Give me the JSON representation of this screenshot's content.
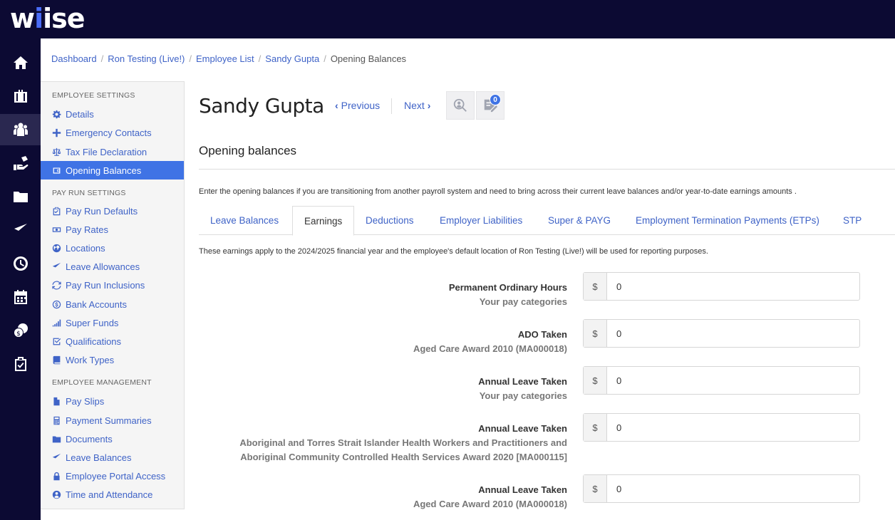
{
  "brand": {
    "logo_pre": "w",
    "logo_i1": "i",
    "logo_i2": "i",
    "logo_post": "se"
  },
  "rail": [
    "home-icon",
    "briefcase-icon",
    "people-icon",
    "hand-coin-icon",
    "folder-icon",
    "plane-icon",
    "clock-icon",
    "calendar-icon",
    "coins-icon",
    "clipboard-check-icon"
  ],
  "breadcrumb": {
    "items": [
      "Dashboard",
      "Ron Testing (Live!)",
      "Employee List",
      "Sandy Gupta"
    ],
    "current": "Opening Balances",
    "separator": "/"
  },
  "panel": {
    "sections": [
      {
        "heading": "EMPLOYEE SETTINGS",
        "items": [
          "Details",
          "Emergency Contacts",
          "Tax File Declaration",
          "Opening Balances"
        ]
      },
      {
        "heading": "PAY RUN SETTINGS",
        "items": [
          "Pay Run Defaults",
          "Pay Rates",
          "Locations",
          "Leave Allowances",
          "Pay Run Inclusions",
          "Bank Accounts",
          "Super Funds",
          "Qualifications",
          "Work Types"
        ]
      },
      {
        "heading": "EMPLOYEE MANAGEMENT",
        "items": [
          "Pay Slips",
          "Payment Summaries",
          "Documents",
          "Leave Balances",
          "Employee Portal Access",
          "Time and Attendance"
        ]
      }
    ],
    "active": "Opening Balances"
  },
  "header": {
    "employee_name": "Sandy Gupta",
    "prev_label": "Previous",
    "next_label": "Next",
    "notes_count": "0"
  },
  "page": {
    "section_title": "Opening balances",
    "intro": "Enter the opening balances if you are transitioning from another payroll system and need to bring across their current leave balances and/or year-to-date earnings amounts .",
    "apply_note": "These earnings apply to the 2024/2025 financial year and the employee's default location of Ron Testing (Live!) will be used for reporting purposes."
  },
  "tabs": {
    "items": [
      "Leave Balances",
      "Earnings",
      "Deductions",
      "Employer Liabilities",
      "Super & PAYG",
      "Employment Termination Payments (ETPs)",
      "STP"
    ],
    "active": "Earnings"
  },
  "fields": [
    {
      "label": "Permanent Ordinary Hours",
      "sub": [
        "Your pay categories"
      ],
      "currency": "$",
      "value": "0"
    },
    {
      "label": "ADO Taken",
      "sub": [
        "Aged Care Award 2010 (MA000018)"
      ],
      "currency": "$",
      "value": "0"
    },
    {
      "label": "Annual Leave Taken",
      "sub": [
        "Your pay categories"
      ],
      "currency": "$",
      "value": "0"
    },
    {
      "label": "Annual Leave Taken",
      "sub": [
        "Aboriginal and Torres Strait Islander Health Workers and Practitioners and",
        "Aboriginal Community Controlled Health Services Award 2020 [MA000115]"
      ],
      "currency": "$",
      "value": "0"
    },
    {
      "label": "Annual Leave Taken",
      "sub": [
        "Aged Care Award 2010 (MA000018)"
      ],
      "currency": "$",
      "value": "0"
    }
  ],
  "colors": {
    "nav_bg": "#0c0a33",
    "accent": "#3f73e5",
    "link": "#3f63c7"
  }
}
